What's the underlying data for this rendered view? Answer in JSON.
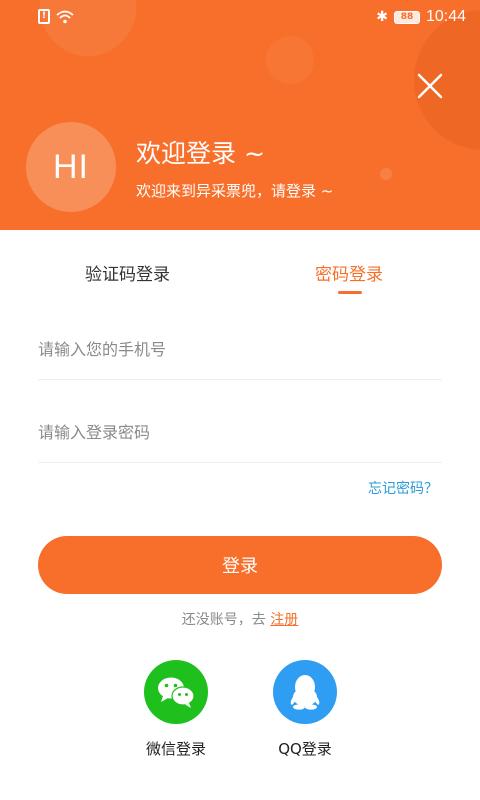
{
  "status_bar": {
    "sim": "!",
    "battery": "88",
    "time": "10:44"
  },
  "header": {
    "avatar_text": "HI",
    "welcome_title": "欢迎登录 ~",
    "welcome_subtitle": "欢迎来到异采票兜，请登录 ~",
    "background_color": "#f76f2a",
    "close_icon": "close-icon"
  },
  "tabs": [
    {
      "label": "验证码登录",
      "active": false
    },
    {
      "label": "密码登录",
      "active": true
    }
  ],
  "form": {
    "phone_placeholder": "请输入您的手机号",
    "phone_value": "",
    "password_placeholder": "请输入登录密码",
    "password_value": "",
    "forgot_label": "忘记密码？",
    "login_label": "登录"
  },
  "register": {
    "prompt": "还没账号，去 ",
    "link": "注册"
  },
  "social": [
    {
      "label": "微信登录",
      "icon": "wechat-icon",
      "color": "#1fc01d"
    },
    {
      "label": "QQ登录",
      "icon": "qq-icon",
      "color": "#2f9df2"
    }
  ],
  "colors": {
    "accent": "#f76f2a",
    "link": "#2a9ad8"
  }
}
